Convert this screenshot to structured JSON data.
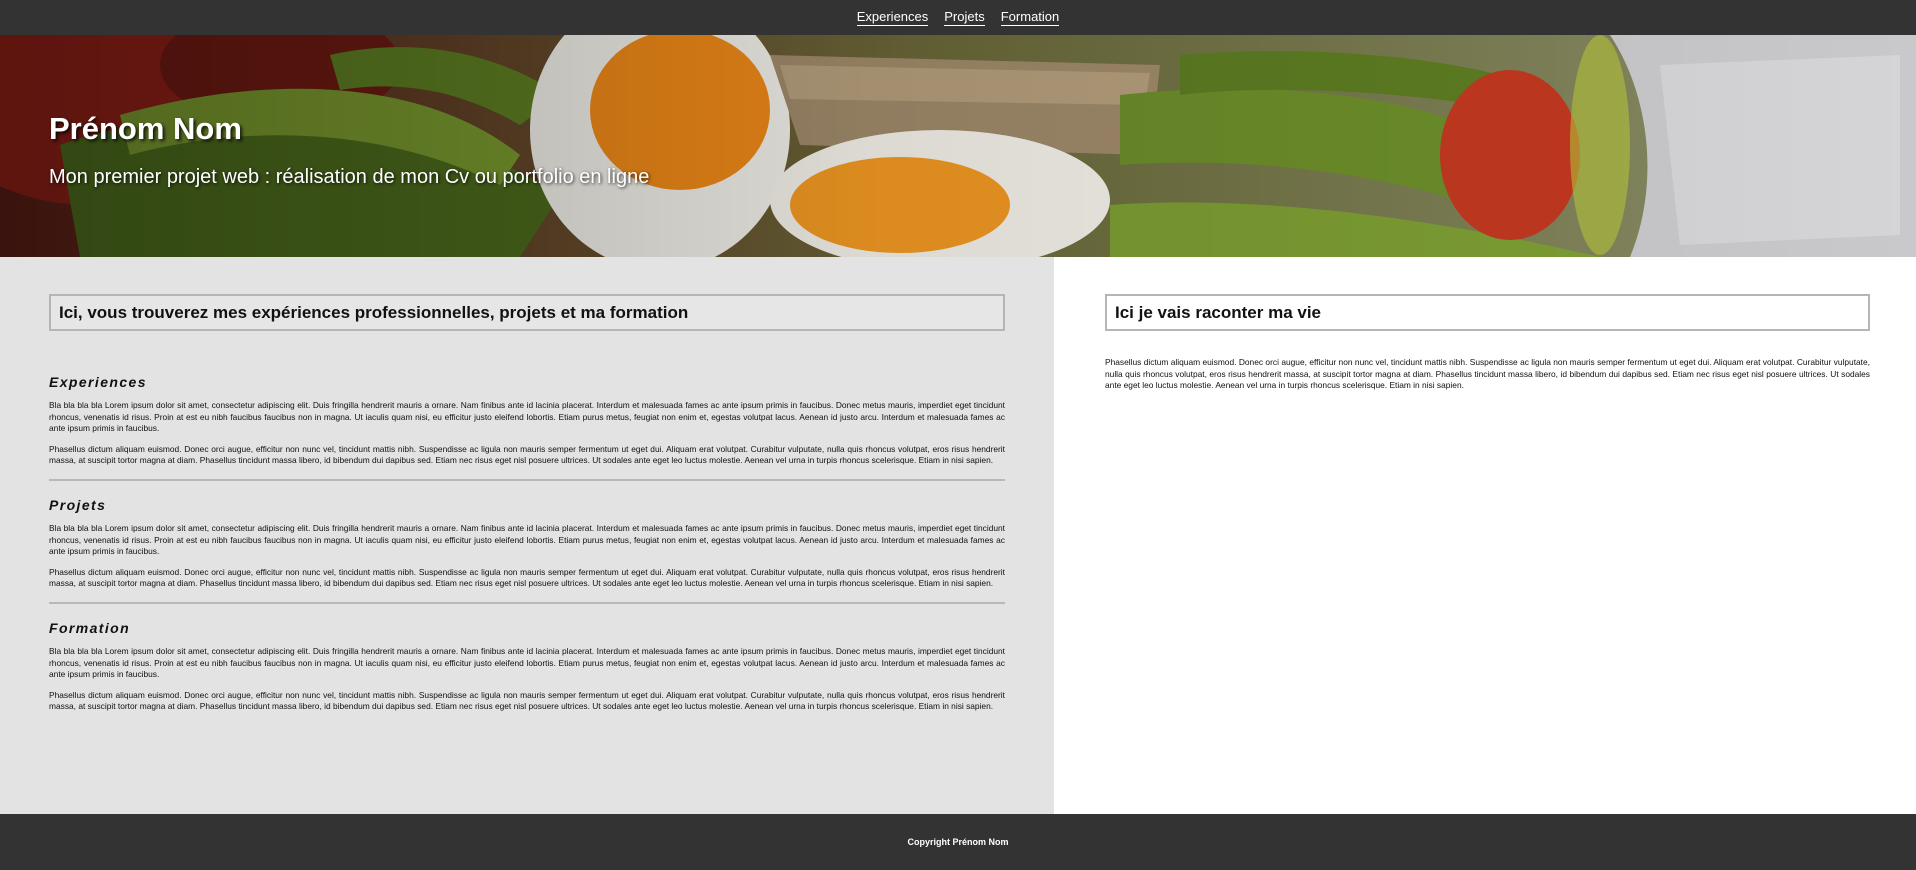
{
  "nav": {
    "items": [
      {
        "label": "Experiences"
      },
      {
        "label": "Projets"
      },
      {
        "label": "Formation"
      }
    ]
  },
  "hero": {
    "name": "Prénom Nom",
    "subtitle": "Mon premier projet web : réalisation de mon Cv ou portfolio en ligne"
  },
  "left": {
    "title": "Ici, vous trouverez mes expériences professionnelles, projets et ma formation",
    "sections": [
      {
        "heading": "Experiences",
        "p1": "Bla bla bla bla Lorem ipsum dolor sit amet, consectetur adipiscing elit. Duis fringilla hendrerit mauris a ornare. Nam finibus ante id lacinia placerat. Interdum et malesuada fames ac ante ipsum primis in faucibus. Donec metus mauris, imperdiet eget tincidunt rhoncus, venenatis id risus. Proin at est eu nibh faucibus faucibus non in magna. Ut iaculis quam nisi, eu efficitur justo eleifend lobortis. Etiam purus metus, feugiat non enim et, egestas volutpat lacus. Aenean id justo arcu. Interdum et malesuada fames ac ante ipsum primis in faucibus.",
        "p2": "Phasellus dictum aliquam euismod. Donec orci augue, efficitur non nunc vel, tincidunt mattis nibh. Suspendisse ac ligula non mauris semper fermentum ut eget dui. Aliquam erat volutpat. Curabitur vulputate, nulla quis rhoncus volutpat, eros risus hendrerit massa, at suscipit tortor magna at diam. Phasellus tincidunt massa libero, id bibendum dui dapibus sed. Etiam nec risus eget nisl posuere ultrices. Ut sodales ante eget leo luctus molestie. Aenean vel urna in turpis rhoncus scelerisque. Etiam in nisi sapien."
      },
      {
        "heading": "Projets",
        "p1": "Bla bla bla bla Lorem ipsum dolor sit amet, consectetur adipiscing elit. Duis fringilla hendrerit mauris a ornare. Nam finibus ante id lacinia placerat. Interdum et malesuada fames ac ante ipsum primis in faucibus. Donec metus mauris, imperdiet eget tincidunt rhoncus, venenatis id risus. Proin at est eu nibh faucibus faucibus non in magna. Ut iaculis quam nisi, eu efficitur justo eleifend lobortis. Etiam purus metus, feugiat non enim et, egestas volutpat lacus. Aenean id justo arcu. Interdum et malesuada fames ac ante ipsum primis in faucibus.",
        "p2": "Phasellus dictum aliquam euismod. Donec orci augue, efficitur non nunc vel, tincidunt mattis nibh. Suspendisse ac ligula non mauris semper fermentum ut eget dui. Aliquam erat volutpat. Curabitur vulputate, nulla quis rhoncus volutpat, eros risus hendrerit massa, at suscipit tortor magna at diam. Phasellus tincidunt massa libero, id bibendum dui dapibus sed. Etiam nec risus eget nisl posuere ultrices. Ut sodales ante eget leo luctus molestie. Aenean vel urna in turpis rhoncus scelerisque. Etiam in nisi sapien."
      },
      {
        "heading": "Formation",
        "p1": "Bla bla bla bla Lorem ipsum dolor sit amet, consectetur adipiscing elit. Duis fringilla hendrerit mauris a ornare. Nam finibus ante id lacinia placerat. Interdum et malesuada fames ac ante ipsum primis in faucibus. Donec metus mauris, imperdiet eget tincidunt rhoncus, venenatis id risus. Proin at est eu nibh faucibus faucibus non in magna. Ut iaculis quam nisi, eu efficitur justo eleifend lobortis. Etiam purus metus, feugiat non enim et, egestas volutpat lacus. Aenean id justo arcu. Interdum et malesuada fames ac ante ipsum primis in faucibus.",
        "p2": "Phasellus dictum aliquam euismod. Donec orci augue, efficitur non nunc vel, tincidunt mattis nibh. Suspendisse ac ligula non mauris semper fermentum ut eget dui. Aliquam erat volutpat. Curabitur vulputate, nulla quis rhoncus volutpat, eros risus hendrerit massa, at suscipit tortor magna at diam. Phasellus tincidunt massa libero, id bibendum dui dapibus sed. Etiam nec risus eget nisl posuere ultrices. Ut sodales ante eget leo luctus molestie. Aenean vel urna in turpis rhoncus scelerisque. Etiam in nisi sapien."
      }
    ]
  },
  "right": {
    "title": "Ici je vais raconter ma vie",
    "text": "Phasellus dictum aliquam euismod. Donec orci augue, efficitur non nunc vel, tincidunt mattis nibh. Suspendisse ac ligula non mauris semper fermentum ut eget dui. Aliquam erat volutpat. Curabitur vulputate, nulla quis rhoncus volutpat, eros risus hendrerit massa, at suscipit tortor magna at diam. Phasellus tincidunt massa libero, id bibendum dui dapibus sed. Etiam nec risus eget nisl posuere ultrices. Ut sodales ante eget leo luctus molestie. Aenean vel urna in turpis rhoncus scelerisque. Etiam in nisi sapien."
  },
  "footer": {
    "copyright": "Copyright Prénom Nom"
  },
  "colors": {
    "nav_bg": "#333333",
    "left_bg": "#e3e3e3",
    "right_bg": "#ffffff",
    "border": "#b5b5b5"
  }
}
